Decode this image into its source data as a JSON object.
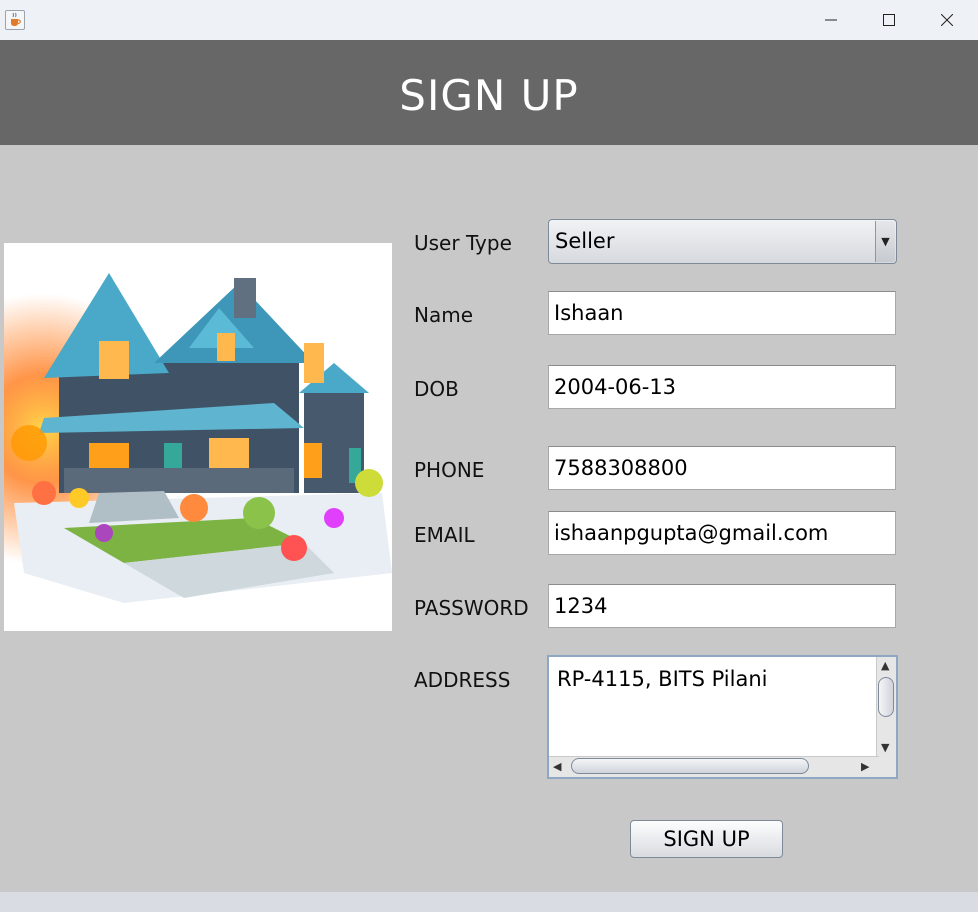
{
  "window": {
    "minimize_glyph": "—",
    "maximize_glyph": "☐",
    "close_glyph": "✕"
  },
  "header": {
    "title": "SIGN UP"
  },
  "form": {
    "user_type_label": "User Type",
    "user_type_value": "Seller",
    "name_label": "Name",
    "name_value": "Ishaan",
    "dob_label": "DOB",
    "dob_value": "2004-06-13",
    "phone_label": "PHONE",
    "phone_value": "7588308800",
    "email_label": "EMAIL",
    "email_value": "ishaanpgupta@gmail.com",
    "password_label": "PASSWORD",
    "password_value": "1234",
    "address_label": "ADDRESS",
    "address_value": "RP-4115, BITS Pilani",
    "submit_label": "SIGN UP"
  },
  "icons": {
    "app": "java-cup-icon",
    "dropdown": "chevron-down-icon",
    "house_image": "house-illustration"
  }
}
